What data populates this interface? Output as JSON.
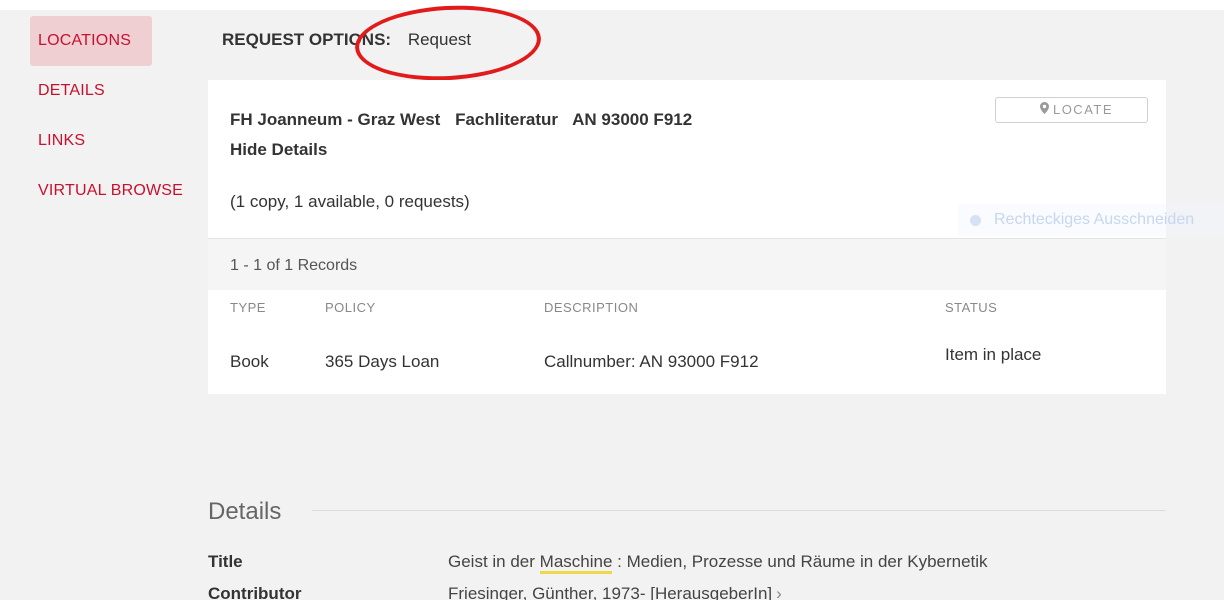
{
  "sidebar": {
    "items": [
      {
        "label": "LOCATIONS",
        "active": true
      },
      {
        "label": "DETAILS",
        "active": false
      },
      {
        "label": "LINKS",
        "active": false
      },
      {
        "label": "VIRTUAL BROWSE",
        "active": false
      }
    ]
  },
  "request": {
    "label": "REQUEST OPTIONS:",
    "link": "Request"
  },
  "holding": {
    "library": "FH Joanneum - Graz West",
    "collection": "Fachliteratur",
    "callnumber": "AN 93000 F912",
    "toggle": "Hide Details",
    "summary": "(1 copy, 1 available, 0 requests)",
    "locate_label": "LOCATE",
    "records": "1 - 1 of 1 Records",
    "columns": [
      "TYPE",
      "POLICY",
      "DESCRIPTION",
      "STATUS"
    ],
    "row": {
      "type": "Book",
      "policy": "365 Days Loan",
      "description": "Callnumber: AN 93000 F912",
      "status": "Item in place"
    }
  },
  "overlay": {
    "text": "Rechteckiges Ausschneiden"
  },
  "details": {
    "heading": "Details",
    "title_label": "Title",
    "title_pre": "Geist in der ",
    "title_highlight": "Maschine",
    "title_post": " : Medien, Prozesse und Räume in der Kybernetik",
    "contributor_label": "Contributor",
    "contributor_value": "Friesinger, Günther, 1973- [HerausgeberIn]"
  },
  "colors": {
    "accent_red": "#c8102e",
    "active_bg": "#f0cfd3",
    "annotation_circle": "#e11a1a"
  }
}
